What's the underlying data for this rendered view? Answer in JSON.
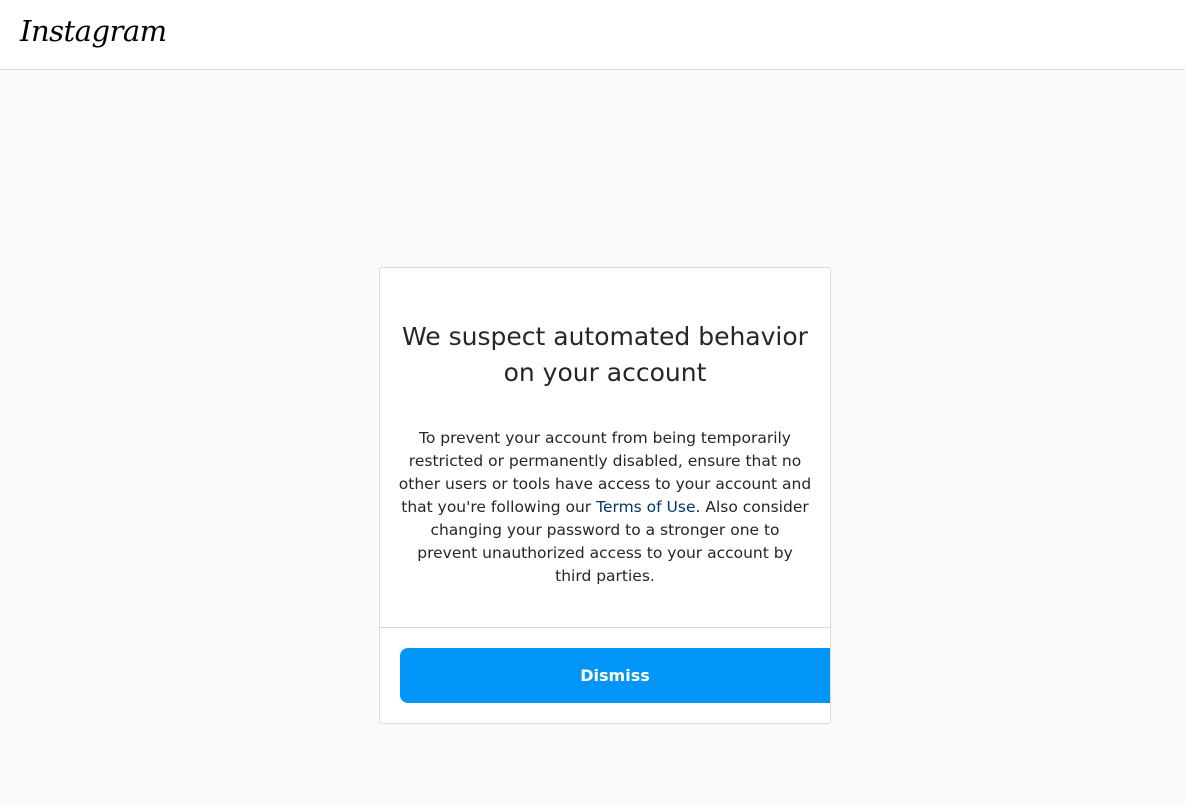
{
  "header": {
    "logo_text": "Instagram"
  },
  "dialog": {
    "title_line1": "We suspect automated behavior",
    "title_line2": "on your account",
    "body_before_link": "To prevent your account from being temporarily restricted or permanently disabled, ensure that no other users or tools have access to your account and that you're following our ",
    "link_text": "Terms of Use",
    "body_after_link": ". Also consider changing your password to a stronger one to prevent unauthorized access to your account by third parties.",
    "dismiss_label": "Dismiss"
  },
  "colors": {
    "accent": "#0095f6",
    "link": "#00376b",
    "background": "#fafafa",
    "border": "#dbdbdb",
    "text": "#262626"
  }
}
